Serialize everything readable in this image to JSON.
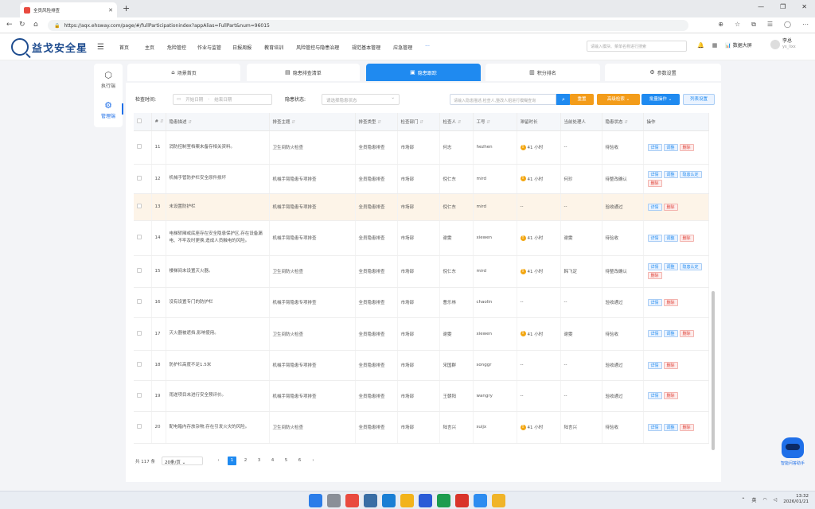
{
  "browser": {
    "tab_title": "全员风险排查",
    "url": "https://aqx.ehsway.com/page/#/fullParticipationindex?appAlias=FullPart&num=96015"
  },
  "header": {
    "logo": "益戈安全星",
    "nav": [
      "首页",
      "主页",
      "危险管控",
      "作业与监管",
      "日报周报",
      "教育培训",
      "风险管控与隐患治理",
      "规范基本管理",
      "应急管理",
      "···"
    ],
    "search_placeholder": "请输入模块、菜单名称进行搜索",
    "screen_label": "数据大屏",
    "user_name": "李总",
    "user_id": "ys_lixx"
  },
  "sidebar": {
    "items": [
      {
        "label": "执行端",
        "icon": "cube-icon"
      },
      {
        "label": "管理端",
        "icon": "gear-icon"
      }
    ]
  },
  "page_tabs": [
    {
      "label": "场景首页",
      "icon": "home-icon"
    },
    {
      "label": "隐患排查清单",
      "icon": "list-icon"
    },
    {
      "label": "隐患跟踪",
      "icon": "track-icon"
    },
    {
      "label": "积分排名",
      "icon": "rank-icon"
    },
    {
      "label": "参数设置",
      "icon": "settings-icon"
    }
  ],
  "filters": {
    "check_time_label": "检查时间:",
    "start_placeholder": "开始日期",
    "range_sep": "-",
    "end_placeholder": "结束日期",
    "status_label": "隐患状态:",
    "status_placeholder": "请选择隐患状态",
    "keyword_placeholder": "请输入隐患描述,检查人,整改人姐进行模糊查询",
    "reset": "重置",
    "advanced": "高级检索",
    "batch": "批量操作",
    "list_settings": "列表设置"
  },
  "table": {
    "headers": [
      "",
      "#",
      "隐患描述",
      "排查主题",
      "排查类型",
      "检查部门",
      "检查人",
      "工号",
      "滞留时长",
      "当前处理人",
      "隐患状态",
      "操作"
    ],
    "rows": [
      {
        "no": "11",
        "desc": "消防控制室档案未备存相关资料。",
        "topic": "卫生间防火检查",
        "type": "全员隐患排查",
        "dept": "市场部",
        "checker": "何志",
        "uid": "hezhen",
        "dur": "41 小时",
        "handler": "--",
        "status": "待验收",
        "actions": [
          "详情",
          "调整",
          "删除"
        ]
      },
      {
        "no": "12",
        "desc": "机械手管防护栏安全原件损坏",
        "topic": "机械手臂隐患专项排查",
        "type": "全员隐患排查",
        "dept": "市场部",
        "checker": "倪仁东",
        "uid": "mird",
        "dur": "41 小时",
        "handler": "何珍",
        "status": "待整改确认",
        "actions": [
          "详情",
          "调整",
          "隐患认定",
          "删除"
        ]
      },
      {
        "no": "13",
        "desc": "未设置防护栏",
        "topic": "机械手臂隐患专项排查",
        "type": "全员隐患排查",
        "dept": "市场部",
        "checker": "倪仁东",
        "uid": "mird",
        "dur": "--",
        "handler": "--",
        "status": "验收通过",
        "actions": [
          "详情",
          "删除"
        ]
      },
      {
        "no": "14",
        "desc": "电梯轿厢或底座存在安全隐患保护区,存在设备漏电、不牢及时更换,造成人员触电的风险。",
        "topic": "机械手臂隐患专项排查",
        "type": "全员隐患排查",
        "dept": "市场部",
        "checker": "谢雯",
        "uid": "xiewen",
        "dur": "41 小时",
        "handler": "谢雯",
        "status": "待验收",
        "actions": [
          "详情",
          "调整",
          "删除"
        ]
      },
      {
        "no": "15",
        "desc": "楼梯间未设置灭火器。",
        "topic": "卫生间防火检查",
        "type": "全员隐患排查",
        "dept": "市场部",
        "checker": "倪仁东",
        "uid": "mird",
        "dur": "41 小时",
        "handler": "韩飞定",
        "status": "待整改确认",
        "actions": [
          "详情",
          "调整",
          "隐患认定",
          "删除"
        ]
      },
      {
        "no": "16",
        "desc": "没有设置专门的防护栏",
        "topic": "机械手臂隐患专项排查",
        "type": "全员隐患排查",
        "dept": "市场部",
        "checker": "曹乐林",
        "uid": "chaolin",
        "dur": "--",
        "handler": "--",
        "status": "验收通过",
        "actions": [
          "详情",
          "删除"
        ]
      },
      {
        "no": "17",
        "desc": "灭火器被遮挡,影响使用。",
        "topic": "卫生间防火检查",
        "type": "全员隐患排查",
        "dept": "市场部",
        "checker": "谢雯",
        "uid": "xiewen",
        "dur": "41 小时",
        "handler": "谢雯",
        "status": "待验收",
        "actions": [
          "详情",
          "调整",
          "删除"
        ]
      },
      {
        "no": "18",
        "desc": "防护栏高度不足1.5米",
        "topic": "机械手臂隐患专项排查",
        "type": "全员隐患排查",
        "dept": "市场部",
        "checker": "宋国群",
        "uid": "songgr",
        "dur": "--",
        "handler": "--",
        "status": "验收通过",
        "actions": [
          "详情",
          "删除"
        ]
      },
      {
        "no": "19",
        "desc": "雨遂项目未进行安全预评价。",
        "topic": "机械手臂隐患专项排查",
        "type": "全员隐患排查",
        "dept": "市场部",
        "checker": "王朝阳",
        "uid": "wangry",
        "dur": "--",
        "handler": "--",
        "status": "验收通过",
        "actions": [
          "详情",
          "删除"
        ]
      },
      {
        "no": "20",
        "desc": "配电箱内存放杂物,存在引发火灾的风险。",
        "topic": "卫生间防火检查",
        "type": "全员隐患排查",
        "dept": "市场部",
        "checker": "陆言兴",
        "uid": "suijx",
        "dur": "41 小时",
        "handler": "陆言兴",
        "status": "待验收",
        "actions": [
          "详情",
          "调整",
          "删除"
        ]
      }
    ]
  },
  "pagination": {
    "total": "共 117 条",
    "page_size": "20条/页",
    "prev": "‹",
    "next": "›",
    "pages": [
      "1",
      "2",
      "3",
      "4",
      "5",
      "6"
    ],
    "current": "1"
  },
  "assistant_label": "智能问答助手",
  "taskbar": {
    "time": "13:32",
    "date": "2026/01/21",
    "ime": "英"
  },
  "colors": {
    "primary": "#1f8af0",
    "warning": "#f39c1a",
    "danger": "#e0463c",
    "brand": "#1e4c8f"
  }
}
